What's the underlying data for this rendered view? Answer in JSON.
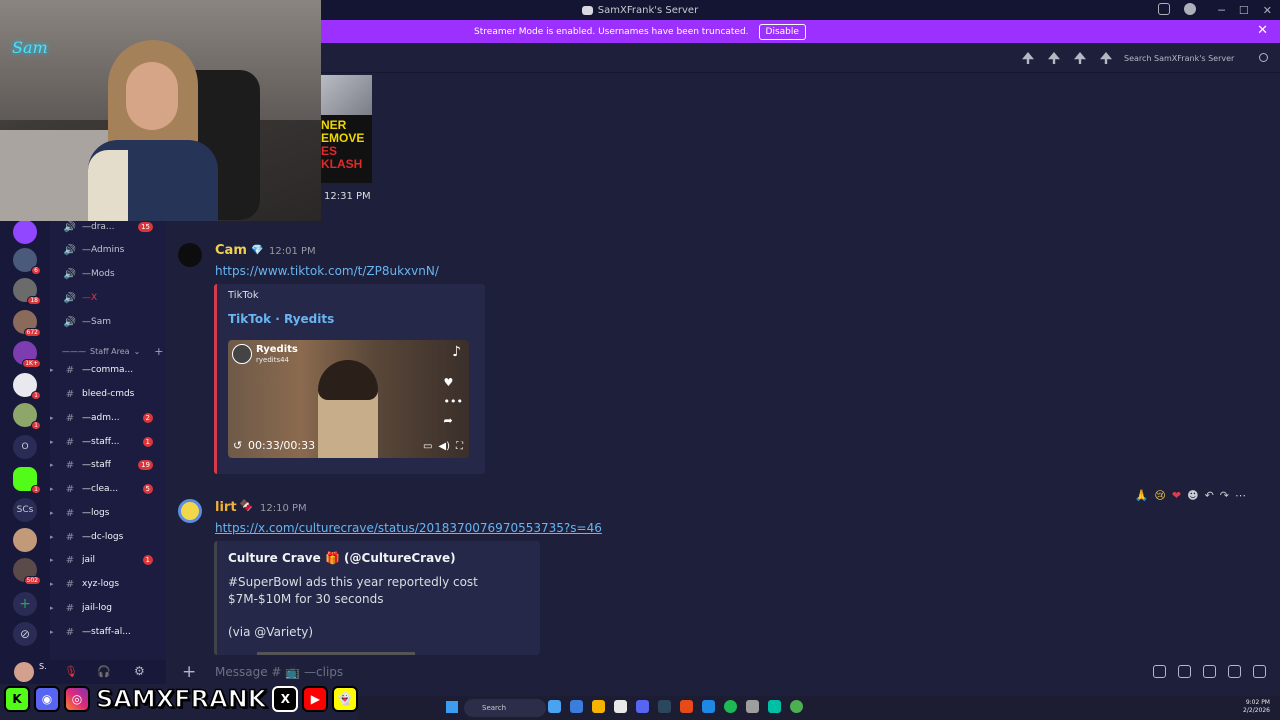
{
  "window": {
    "title": "SamXFrank's Server",
    "controls": [
      "─",
      "☐",
      "✕"
    ]
  },
  "banner": {
    "text": "Streamer Mode is enabled. Usernames have been truncated.",
    "button": "Disable",
    "close": "✕"
  },
  "header": {
    "search_placeholder": "Search SamXFrank's Server"
  },
  "rail": {
    "servers": [
      {
        "badge": ""
      },
      {
        "badge": "6"
      },
      {
        "badge": "18"
      },
      {
        "badge": "672"
      },
      {
        "badge": "1K+"
      },
      {
        "badge": "1"
      },
      {
        "badge": "1"
      },
      {
        "text": "O"
      },
      {
        "badge": "1"
      },
      {
        "text": "SCs"
      },
      {
        "badge": ""
      },
      {
        "badge": "502"
      }
    ],
    "add": "+"
  },
  "sidebar": {
    "category": "Staff Area",
    "channels": [
      {
        "icon": "🔊",
        "label": "—dra...",
        "count": "15"
      },
      {
        "icon": "🔊",
        "label": "—Admins",
        "count": ""
      },
      {
        "icon": "🔊",
        "label": "—Mods",
        "count": ""
      },
      {
        "icon": "🔊",
        "label": "—X",
        "count": ""
      },
      {
        "icon": "🔊",
        "label": "—Sam",
        "count": ""
      },
      {
        "icon": "#",
        "label": "—comma...",
        "count": ""
      },
      {
        "icon": "#",
        "label": "bleed-cmds",
        "count": ""
      },
      {
        "icon": "#",
        "label": "—adm...",
        "count": "2"
      },
      {
        "icon": "#",
        "label": "—staff...",
        "count": "1"
      },
      {
        "icon": "#",
        "label": "—staff",
        "count": "19"
      },
      {
        "icon": "#",
        "label": "—clea...",
        "count": "5"
      },
      {
        "icon": "#",
        "label": "—logs",
        "count": ""
      },
      {
        "icon": "#",
        "label": "—dc-logs",
        "count": ""
      },
      {
        "icon": "#",
        "label": "jail",
        "count": "1"
      },
      {
        "icon": "#",
        "label": "xyz-logs",
        "count": ""
      },
      {
        "icon": "#",
        "label": "jail-log",
        "count": ""
      },
      {
        "icon": "#",
        "label": "—staff-al...",
        "count": ""
      }
    ]
  },
  "webcam": {
    "neon_sign": "Sam"
  },
  "messages": {
    "previous": {
      "image_text_line1": "NER",
      "image_text_line2": "EMOVE",
      "image_text_line3": "ES",
      "image_text_line4": "KLASH",
      "time": "12:31 PM"
    },
    "cam": {
      "author": "Cam",
      "author_color": "#f2d04b",
      "time": "12:01 PM",
      "link": "https://www.tiktok.com/t/ZP8ukxvnN/",
      "embed": {
        "provider": "TikTok",
        "title": "TikTok · Ryedits",
        "video_channel": "Ryedits",
        "video_handle": "ryedits44",
        "duration": "00:33/00:33"
      }
    },
    "lirt": {
      "author": "lirt",
      "author_color": "#f0b232",
      "time": "12:10 PM",
      "link": "https://x.com/culturecrave/status/2018370076970553735?s=46",
      "embed": {
        "author": "Culture Crave 🎁 (@CultureCrave)",
        "body": "#SuperBowl ads this year reportedly cost $7M-$10M for 30 seconds",
        "via": "(via @Variety)"
      },
      "reactions": [
        "🙏",
        "😢",
        "❤",
        "☻",
        "↶",
        "↷",
        "⋯"
      ]
    }
  },
  "composer": {
    "placeholder": "Message # 📺 —clips"
  },
  "userpanel": {
    "name": "S.",
    "sub": "L."
  },
  "social": {
    "handle": "SAMXFRANK"
  },
  "taskbar": {
    "search": "Search",
    "time": "9:02 PM",
    "date": "2/2/2026"
  }
}
